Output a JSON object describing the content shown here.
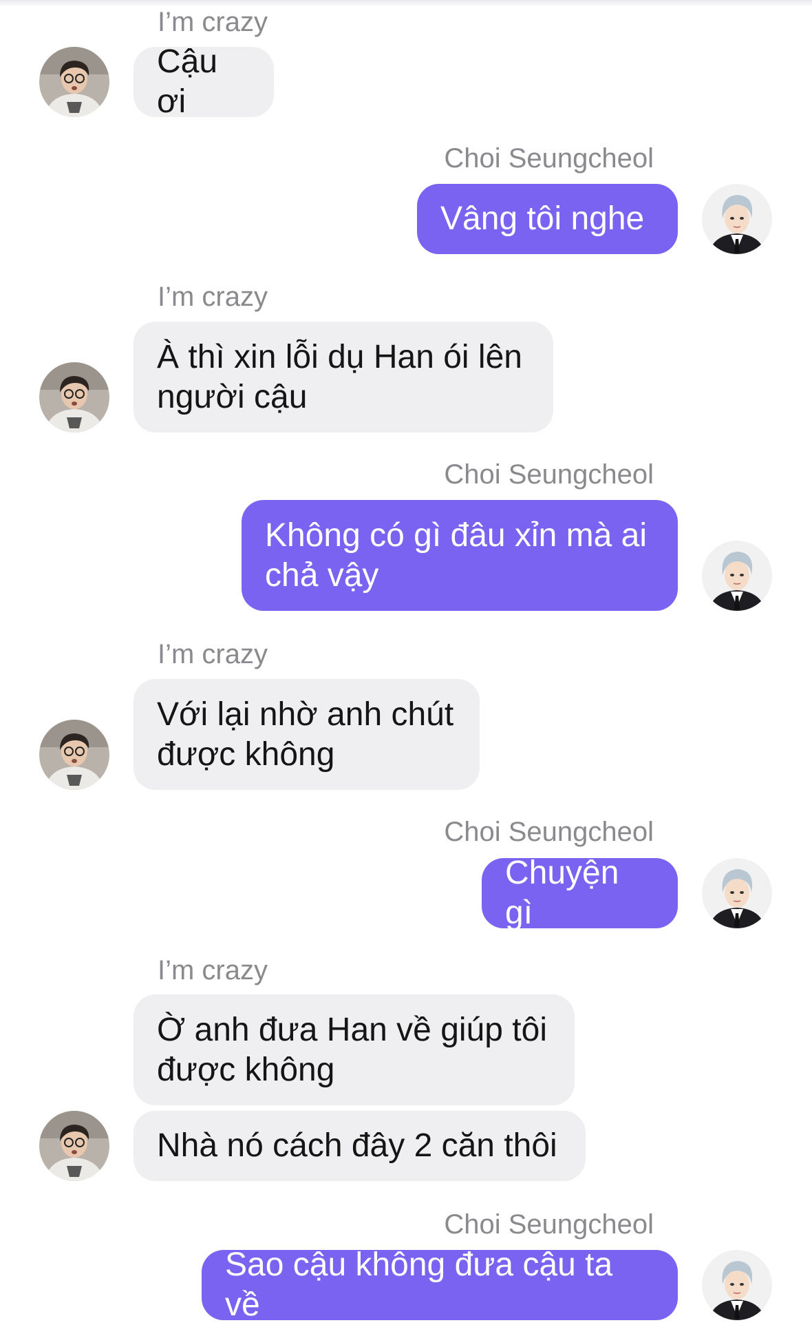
{
  "chat": {
    "participants": {
      "other": {
        "name": "I’m crazy",
        "avatar_icon": "user-photo-icon"
      },
      "me": {
        "name": "Choi Seungcheol",
        "avatar_icon": "user-photo-icon"
      }
    },
    "messages": [
      {
        "sender": "other",
        "name": "I’m crazy",
        "text": "Cậu ơi"
      },
      {
        "sender": "me",
        "name": "Choi Seungcheol",
        "text": "Vâng tôi nghe"
      },
      {
        "sender": "other",
        "name": "I’m crazy",
        "text": "À thì xin lỗi dụ Han ói lên người cậu"
      },
      {
        "sender": "me",
        "name": "Choi Seungcheol",
        "text": "Không có gì đâu xỉn mà ai chả vậy"
      },
      {
        "sender": "other",
        "name": "I’m crazy",
        "text": "Với lại nhờ anh chút được không"
      },
      {
        "sender": "me",
        "name": "Choi Seungcheol",
        "text": "Chuyện gì"
      },
      {
        "sender": "other",
        "name": "I’m crazy",
        "text": "Ờ anh đưa Han về giúp tôi được không"
      },
      {
        "sender": "other",
        "name": "",
        "text": "Nhà nó cách đây 2 căn thôi"
      },
      {
        "sender": "me",
        "name": "Choi Seungcheol",
        "text": "Sao cậu không đưa cậu ta về"
      }
    ]
  },
  "colors": {
    "incoming_bubble": "#efeff1",
    "outgoing_bubble": "#7a63f0",
    "name_label": "#8a8a8e"
  }
}
